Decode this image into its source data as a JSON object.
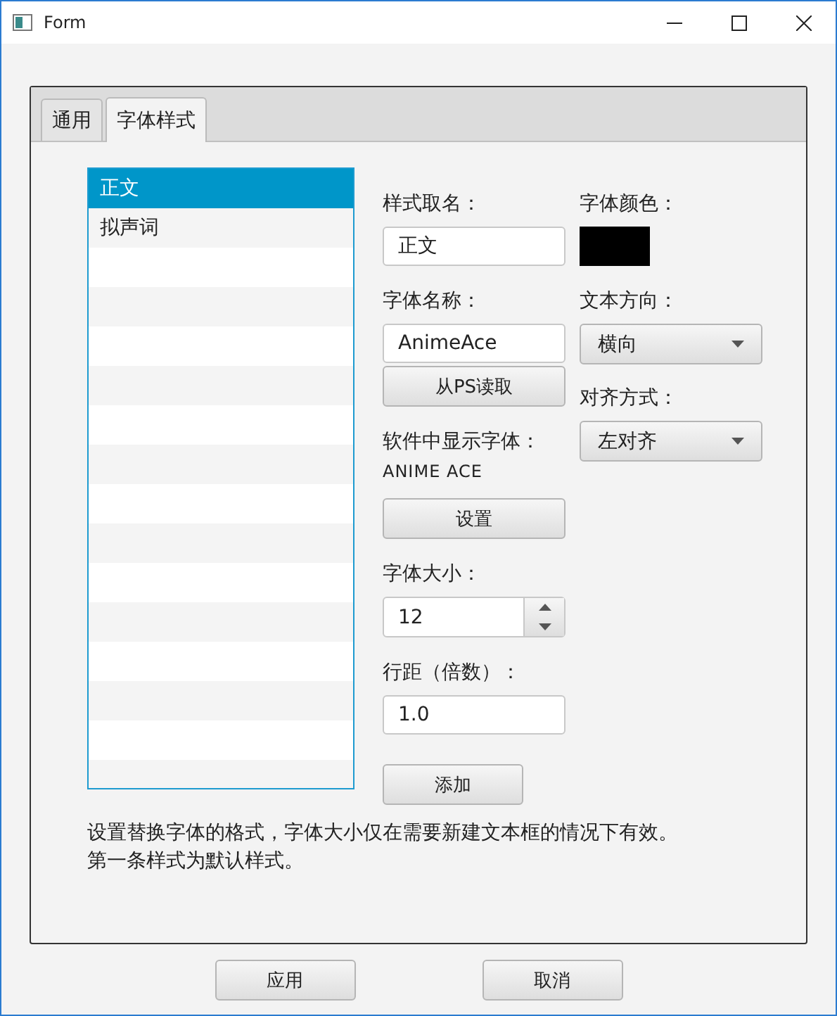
{
  "window": {
    "title": "Form"
  },
  "tabs": [
    {
      "label": "通用",
      "selected": false
    },
    {
      "label": "字体样式",
      "selected": true
    }
  ],
  "style_list": [
    {
      "label": "正文",
      "selected": true
    },
    {
      "label": "拟声词",
      "selected": false
    }
  ],
  "style_name": {
    "label": "样式取名：",
    "value": "正文"
  },
  "font_name": {
    "label": "字体名称：",
    "value": "AnimeAce",
    "read_button": "从PS读取"
  },
  "display_font": {
    "label": "软件中显示字体：",
    "value": "ANIME ACE",
    "set_button": "设置"
  },
  "font_size": {
    "label": "字体大小：",
    "value": "12"
  },
  "line_spacing": {
    "label": "行距（倍数）：",
    "value": "1.0"
  },
  "add_button": "添加",
  "font_color": {
    "label": "字体颜色：",
    "color": "#000000"
  },
  "text_direction": {
    "label": "文本方向：",
    "value": "横向"
  },
  "alignment": {
    "label": "对齐方式：",
    "value": "左对齐"
  },
  "note": [
    "设置替换字体的格式，字体大小仅在需要新建文本框的情况下有效。",
    "第一条样式为默认样式。"
  ],
  "buttons": [
    "应用",
    "取消"
  ]
}
